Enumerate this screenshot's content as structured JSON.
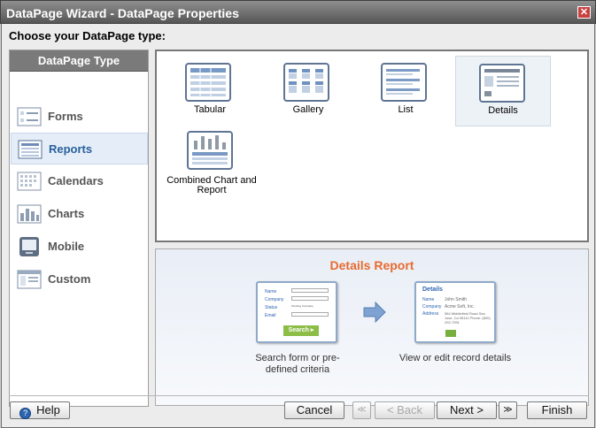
{
  "window": {
    "title": "DataPage Wizard - DataPage Properties",
    "close_glyph": "✕"
  },
  "prompt": "Choose your DataPage type:",
  "sidebar": {
    "title": "DataPage Type",
    "items": [
      {
        "label": "Forms",
        "icon": "forms-icon"
      },
      {
        "label": "Reports",
        "icon": "reports-icon"
      },
      {
        "label": "Calendars",
        "icon": "calendars-icon"
      },
      {
        "label": "Charts",
        "icon": "charts-icon"
      },
      {
        "label": "Mobile",
        "icon": "mobile-icon"
      },
      {
        "label": "Custom",
        "icon": "custom-icon"
      }
    ],
    "selected": "Reports"
  },
  "types": [
    {
      "label": "Tabular",
      "icon": "tabular-icon"
    },
    {
      "label": "Gallery",
      "icon": "gallery-icon"
    },
    {
      "label": "List",
      "icon": "list-icon"
    },
    {
      "label": "Details",
      "icon": "details-icon"
    },
    {
      "label": "Combined Chart and Report",
      "icon": "combined-chart-report-icon"
    }
  ],
  "preview": {
    "title": "Details Report",
    "left_caption": "Search form or pre-defined criteria",
    "right_caption": "View or edit record details",
    "search_mock": {
      "fields": [
        "Name",
        "Company",
        "Status",
        "Email"
      ],
      "status_options": "Pending Complete",
      "button": "Search ▸"
    },
    "details_mock": {
      "heading": "Details",
      "name_label": "Name",
      "name_value": "John Smith",
      "company_label": "Company",
      "company_value": "Acme Soft, Inc.",
      "address_label": "Address",
      "address_value": "584 Middlefield Road San Jose, Ca 95111 Phone: (800) 292-7991"
    }
  },
  "buttons": {
    "help": "Help",
    "cancel": "Cancel",
    "first": "≪",
    "back": "< Back",
    "next": "Next >",
    "last": "≫",
    "finish": "Finish"
  },
  "colors": {
    "accent": "#295f9c",
    "preview_title": "#e86a2f",
    "window_title": "#565656"
  }
}
